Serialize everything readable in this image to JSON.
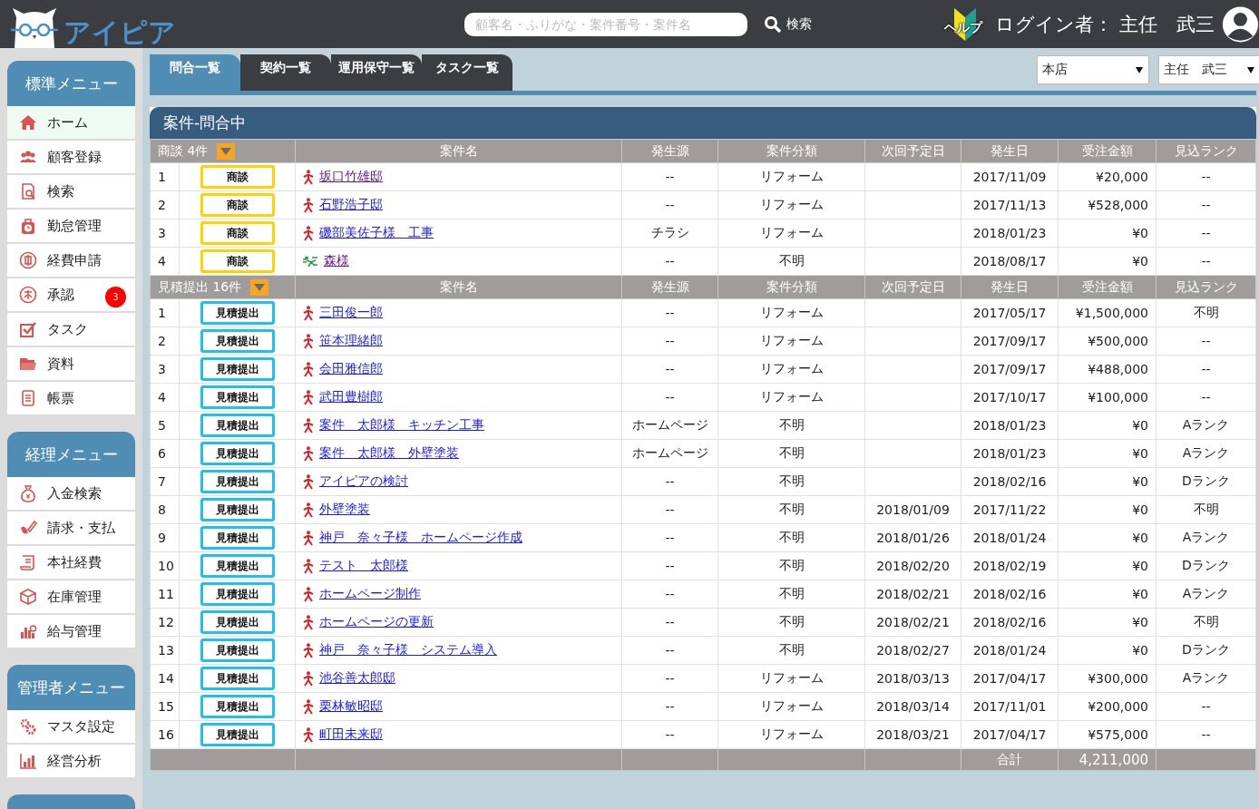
{
  "header": {
    "logo": "アイピア",
    "search": {
      "placeholder": "顧客名・ふりがな・案件番号・案件名",
      "button": "検索"
    },
    "help": "ヘルプ",
    "login": "ログイン者： 主任　武三"
  },
  "sidebar": [
    {
      "title": "標準メニュー",
      "items": [
        {
          "label": "ホーム",
          "selected": true
        },
        {
          "label": "顧客登録",
          "selected": false
        },
        {
          "label": "検索",
          "selected": false
        },
        {
          "label": "勤怠管理",
          "selected": false
        },
        {
          "label": "経費申請",
          "selected": false
        },
        {
          "label": "承認",
          "selected": false,
          "badge": "3"
        },
        {
          "label": "タスク",
          "selected": false
        },
        {
          "label": "資料",
          "selected": false
        },
        {
          "label": "帳票",
          "selected": false
        }
      ]
    },
    {
      "title": "経理メニュー",
      "items": [
        {
          "label": "入金検索",
          "selected": false
        },
        {
          "label": "請求・支払",
          "selected": false
        },
        {
          "label": "本社経費",
          "selected": false
        },
        {
          "label": "在庫管理",
          "selected": false
        },
        {
          "label": "給与管理",
          "selected": false
        }
      ]
    },
    {
      "title": "管理者メニュー",
      "items": [
        {
          "label": "マスタ設定",
          "selected": false
        },
        {
          "label": "経営分析",
          "selected": false
        }
      ]
    }
  ],
  "tabs": [
    {
      "label": "問合一覧",
      "selected": true
    },
    {
      "label": "契約一覧",
      "selected": false
    },
    {
      "label": "運用保守一覧",
      "selected": false
    },
    {
      "label": "タスク一覧",
      "selected": false
    }
  ],
  "selects": [
    {
      "value": "本店"
    },
    {
      "value": "主任　武三"
    }
  ],
  "panel": {
    "title": "案件-問合中",
    "groups": [
      {
        "title": "商談 4件",
        "color": "#ffd200",
        "columns": [
          "案件名",
          "発生源",
          "案件分類",
          "次回予定日",
          "発生日",
          "受注金額",
          "見込ランク"
        ],
        "rows": [
          {
            "no": "1",
            "status": "商談",
            "kind": "walk",
            "name": "坂口竹雄邸",
            "visited": true,
            "source": "--",
            "category": "リフォーム",
            "date": "2017/11/09",
            "amount": "¥20,000",
            "rank": "--"
          },
          {
            "no": "2",
            "status": "商談",
            "kind": "walk",
            "name": "石野浩子邸",
            "visited": false,
            "source": "--",
            "category": "リフォーム",
            "date": "2017/11/13",
            "amount": "¥528,000",
            "rank": "--"
          },
          {
            "no": "3",
            "status": "商談",
            "kind": "walk",
            "name": "磯部美佐子様　工事",
            "visited": false,
            "source": "チラシ",
            "category": "リフォーム",
            "date": "2018/01/23",
            "amount": "¥0",
            "rank": "--"
          },
          {
            "no": "4",
            "status": "商談",
            "kind": "run",
            "name": "森様",
            "visited": true,
            "source": "--",
            "category": "不明",
            "date": "2018/08/17",
            "amount": "¥0",
            "rank": "--"
          }
        ]
      },
      {
        "title": "見積提出 16件",
        "color": "#1ec0f0",
        "columns": [
          "案件名",
          "発生源",
          "案件分類",
          "次回予定日",
          "発生日",
          "受注金額",
          "見込ランク"
        ],
        "rows": [
          {
            "no": "1",
            "status": "見積提出",
            "kind": "walk",
            "name": "三田俊一郎",
            "visited": false,
            "source": "--",
            "category": "リフォーム",
            "date": "2017/05/17",
            "amount": "¥1,500,000",
            "rank": "不明"
          },
          {
            "no": "2",
            "status": "見積提出",
            "kind": "walk",
            "name": "笹本理緒郎",
            "visited": false,
            "source": "--",
            "category": "リフォーム",
            "date": "2017/09/17",
            "amount": "¥500,000",
            "rank": "--"
          },
          {
            "no": "3",
            "status": "見積提出",
            "kind": "walk",
            "name": "会田雅信郎",
            "visited": false,
            "source": "--",
            "category": "リフォーム",
            "date": "2017/09/17",
            "amount": "¥488,000",
            "rank": "--"
          },
          {
            "no": "4",
            "status": "見積提出",
            "kind": "walk",
            "name": "武田豊樹郎",
            "visited": false,
            "source": "--",
            "category": "リフォーム",
            "date": "2017/10/17",
            "amount": "¥100,000",
            "rank": "--"
          },
          {
            "no": "5",
            "status": "見積提出",
            "kind": "walk",
            "name": "案件　太郎様　キッチン工事",
            "visited": false,
            "source": "ホームページ",
            "category": "不明",
            "date": "2018/01/23",
            "amount": "¥0",
            "rank": "Aランク"
          },
          {
            "no": "6",
            "status": "見積提出",
            "kind": "walk",
            "name": "案件　太郎様　外壁塗装",
            "visited": false,
            "source": "ホームページ",
            "category": "不明",
            "date": "2018/01/23",
            "amount": "¥0",
            "rank": "Aランク"
          },
          {
            "no": "7",
            "status": "見積提出",
            "kind": "walk",
            "name": "アイピアの検討",
            "visited": false,
            "source": "--",
            "category": "不明",
            "date": "2018/02/16",
            "amount": "¥0",
            "rank": "Dランク"
          },
          {
            "no": "8",
            "status": "見積提出",
            "kind": "walk",
            "name": "外壁塗装",
            "visited": false,
            "source": "--",
            "category": "不明",
            "next": "2018/01/09",
            "date": "2017/11/22",
            "amount": "¥0",
            "rank": "不明"
          },
          {
            "no": "9",
            "status": "見積提出",
            "kind": "walk",
            "name": "神戸　奈々子様　ホームページ作成",
            "visited": false,
            "source": "--",
            "category": "不明",
            "next": "2018/01/26",
            "date": "2018/01/24",
            "amount": "¥0",
            "rank": "Aランク"
          },
          {
            "no": "10",
            "status": "見積提出",
            "kind": "walk",
            "name": "テスト　太郎様",
            "visited": false,
            "source": "--",
            "category": "不明",
            "next": "2018/02/20",
            "date": "2018/02/19",
            "amount": "¥0",
            "rank": "Dランク"
          },
          {
            "no": "11",
            "status": "見積提出",
            "kind": "walk",
            "name": "ホームページ制作",
            "visited": false,
            "source": "--",
            "category": "不明",
            "next": "2018/02/21",
            "date": "2018/02/16",
            "amount": "¥0",
            "rank": "Aランク"
          },
          {
            "no": "12",
            "status": "見積提出",
            "kind": "walk",
            "name": "ホームページの更新",
            "visited": false,
            "source": "--",
            "category": "不明",
            "next": "2018/02/21",
            "date": "2018/02/16",
            "amount": "¥0",
            "rank": "不明"
          },
          {
            "no": "13",
            "status": "見積提出",
            "kind": "walk",
            "name": "神戸　奈々子様　システム導入",
            "visited": false,
            "source": "--",
            "category": "不明",
            "next": "2018/02/27",
            "date": "2018/01/24",
            "amount": "¥0",
            "rank": "Dランク"
          },
          {
            "no": "14",
            "status": "見積提出",
            "kind": "walk",
            "name": "池谷善太郎邸",
            "visited": false,
            "source": "--",
            "category": "リフォーム",
            "next": "2018/03/13",
            "date": "2017/04/17",
            "amount": "¥300,000",
            "rank": "Aランク"
          },
          {
            "no": "15",
            "status": "見積提出",
            "kind": "walk",
            "name": "栗林敏昭邸",
            "visited": false,
            "source": "--",
            "category": "リフォーム",
            "next": "2018/03/14",
            "date": "2017/11/01",
            "amount": "¥200,000",
            "rank": "--"
          },
          {
            "no": "16",
            "status": "見積提出",
            "kind": "walk",
            "name": "町田未来邸",
            "visited": false,
            "source": "--",
            "category": "リフォーム",
            "next": "2018/03/21",
            "date": "2017/04/17",
            "amount": "¥575,000",
            "rank": "--"
          }
        ]
      }
    ],
    "footer": {
      "label": "合計",
      "total": "4,211,000"
    }
  }
}
